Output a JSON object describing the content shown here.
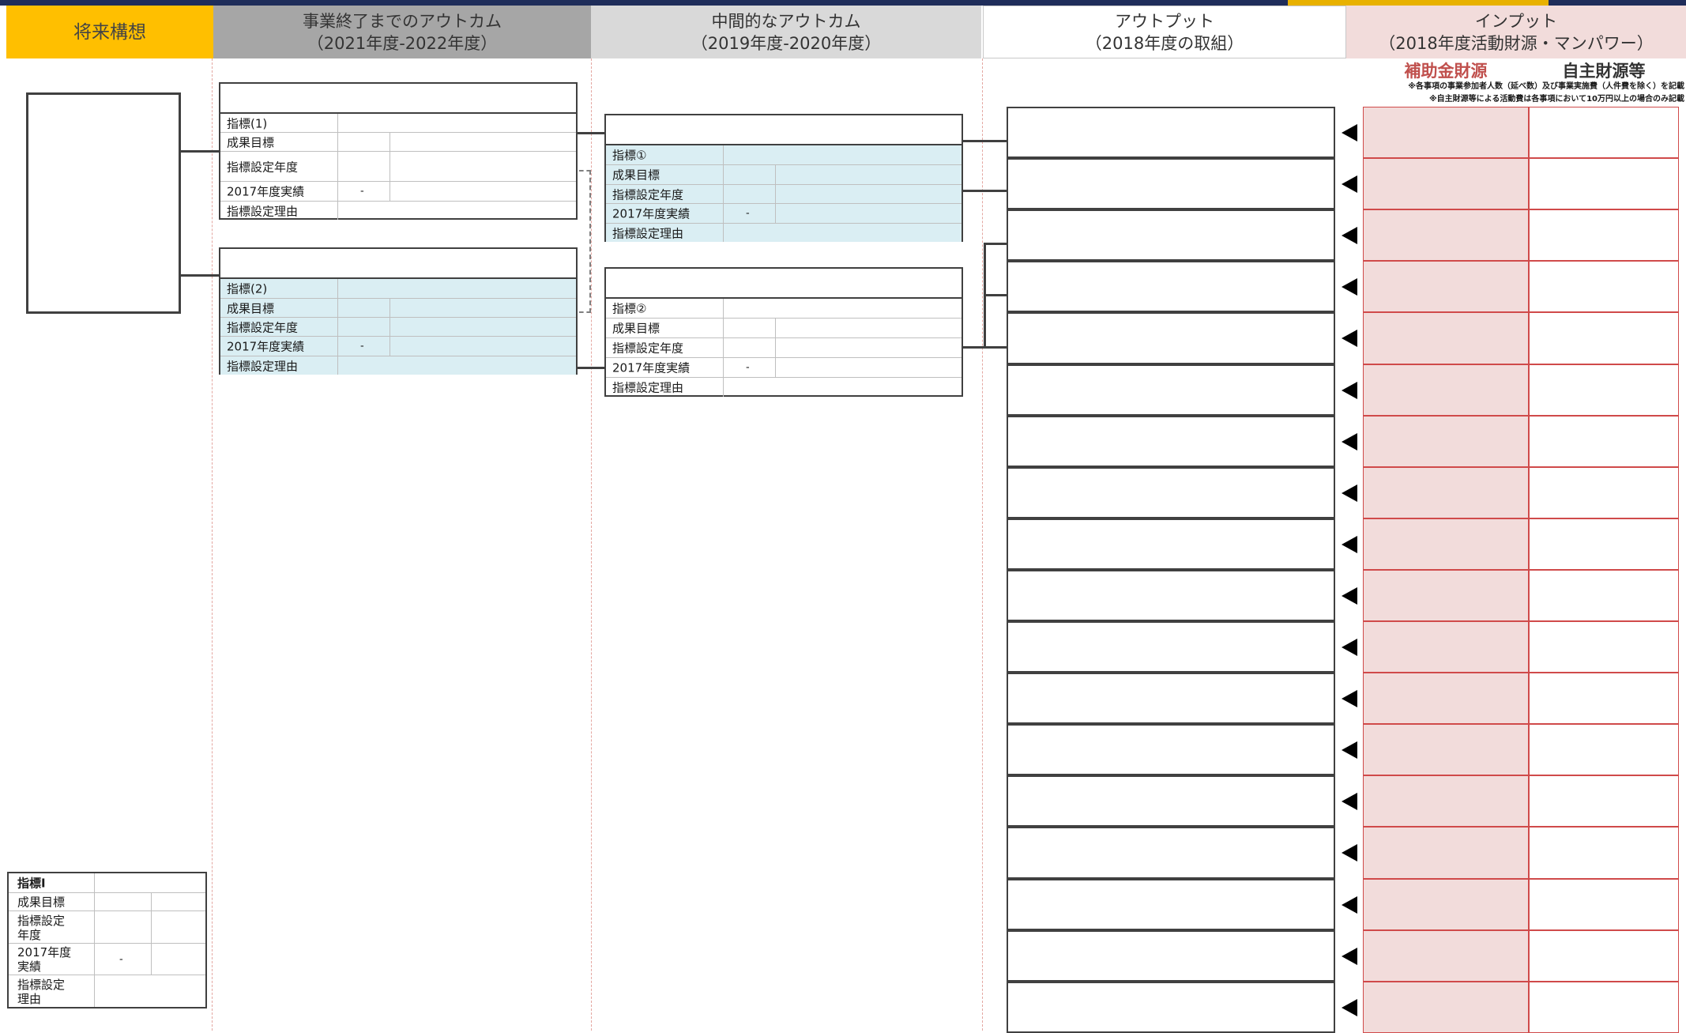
{
  "headers": {
    "vision": "将来構想",
    "final_outcome": {
      "line1": "事業終了までのアウトカム",
      "line2": "（2021年度-2022年度）"
    },
    "mid_outcome": {
      "line1": "中間的なアウトカム",
      "line2": "（2019年度-2020年度）"
    },
    "output": {
      "line1": "アウトプット",
      "line2": "（2018年度の取組）"
    },
    "input": {
      "line1": "インプット",
      "line2": "（2018年度活動財源・マンパワー）"
    }
  },
  "input_columns": {
    "subsidy": "補助金財源",
    "own": "自主財源等",
    "note1": "※各事項の事業参加者人数（延べ数）及び事業実施費（人件費を除く）を記載",
    "note2": "※自主財源等による活動費は各事項において10万円以上の場合のみ記載"
  },
  "final_outcomes": [
    {
      "title": "",
      "rows": {
        "indicator": "指標(1)",
        "target": "成果目標",
        "year": "指標設定年度",
        "actual": "2017年度実績",
        "actual_value": "-",
        "reason": "指標設定理由"
      }
    },
    {
      "title": "",
      "rows": {
        "indicator": "指標(2)",
        "target": "成果目標",
        "year": "指標設定年度",
        "actual": "2017年度実績",
        "actual_value": "-",
        "reason": "指標設定理由"
      }
    }
  ],
  "mid_outcomes": [
    {
      "title": "",
      "rows": {
        "indicator": "指標①",
        "target": "成果目標",
        "year": "指標設定年度",
        "actual": "2017年度実績",
        "actual_value": "-",
        "reason": "指標設定理由"
      }
    },
    {
      "title": "",
      "rows": {
        "indicator": "指標②",
        "target": "成果目標",
        "year": "指標設定年度",
        "actual": "2017年度実績",
        "actual_value": "-",
        "reason": "指標設定理由"
      }
    }
  ],
  "vision_indicator": {
    "indicator": "指標Ⅰ",
    "target": "成果目標",
    "year_l1": "指標設定",
    "year_l2": "年度",
    "actual_l1": "2017年度",
    "actual_l2": "実績",
    "actual_value": "-",
    "reason_l1": "指標設定",
    "reason_l2": "理由"
  },
  "output_rows": 18
}
